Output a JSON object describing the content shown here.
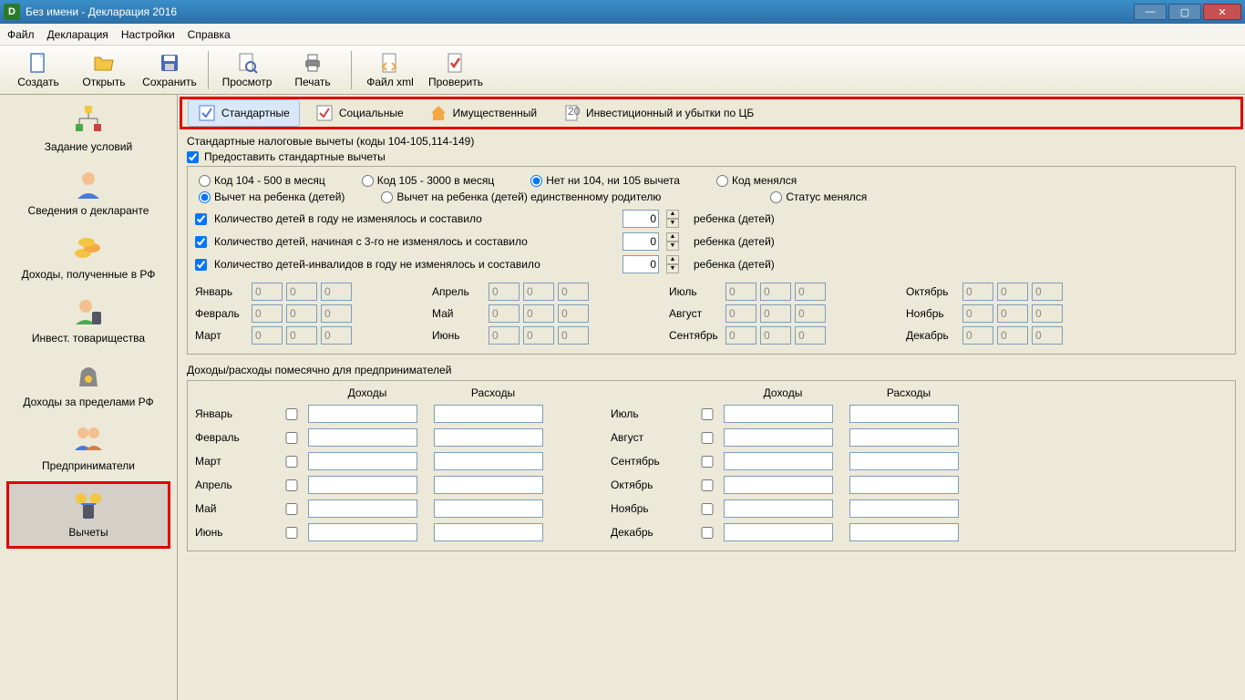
{
  "window": {
    "title": "Без имени - Декларация 2016"
  },
  "menu": {
    "file": "Файл",
    "decl": "Декларация",
    "settings": "Настройки",
    "help": "Справка"
  },
  "toolbar": {
    "create": "Создать",
    "open": "Открыть",
    "save": "Сохранить",
    "preview": "Просмотр",
    "print": "Печать",
    "xml": "Файл xml",
    "check": "Проверить"
  },
  "sidebar": {
    "s1": "Задание условий",
    "s2": "Сведения о декларанте",
    "s3": "Доходы, полученные в РФ",
    "s4": "Инвест. товарищества",
    "s5": "Доходы за пределами РФ",
    "s6": "Предприниматели",
    "s7": "Вычеты"
  },
  "tabs": {
    "t1": "Стандартные",
    "t2": "Социальные",
    "t3": "Имущественный",
    "t4": "Инвестиционный и убытки по ЦБ"
  },
  "section": {
    "title": "Стандартные налоговые вычеты (коды 104-105,114-149)",
    "provide": "Предоставить стандартные вычеты",
    "r1": "Код 104 - 500 в месяц",
    "r2": "Код 105 - 3000 в месяц",
    "r3": "Нет ни 104, ни 105 вычета",
    "r4": "Код менялся",
    "r5": "Вычет на ребенка (детей)",
    "r6": "Вычет на ребенка (детей) единственному родителю",
    "r7": "Статус менялся",
    "c1": "Количество детей в году не изменялось и составило",
    "c2": "Количество детей, начиная с 3-го не изменялось и составило",
    "c3": "Количество детей-инвалидов в году не изменялось и составило",
    "childLabel": "ребенка (детей)",
    "spinVal": "0"
  },
  "months": {
    "m1": "Январь",
    "m2": "Февраль",
    "m3": "Март",
    "m4": "Апрель",
    "m5": "Май",
    "m6": "Июнь",
    "m7": "Июль",
    "m8": "Август",
    "m9": "Сентябрь",
    "m10": "Октябрь",
    "m11": "Ноябрь",
    "m12": "Декабрь",
    "val": "0"
  },
  "entre": {
    "title": "Доходы/расходы помесячно для предпринимателей",
    "income": "Доходы",
    "expense": "Расходы"
  }
}
